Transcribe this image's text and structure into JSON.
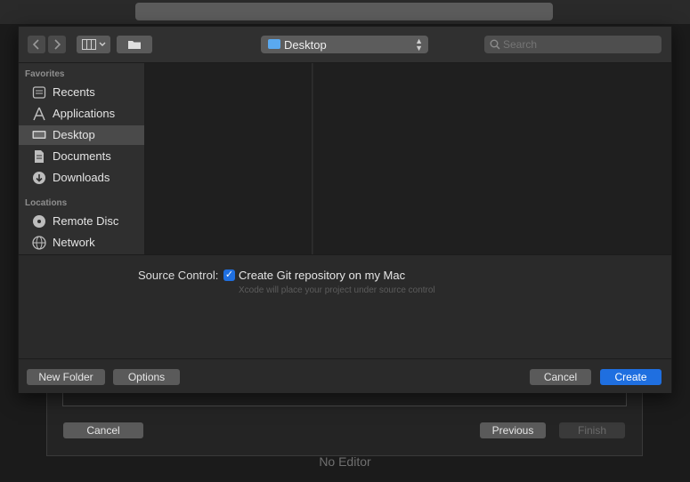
{
  "background": {
    "cancel_label": "Cancel",
    "previous_label": "Previous",
    "finish_label": "Finish",
    "no_editor": "No Editor"
  },
  "toolbar": {
    "location": "Desktop",
    "search_placeholder": "Search",
    "back_icon": "chevron-left-icon",
    "forward_icon": "chevron-right-icon",
    "view_icon": "column-view-icon",
    "new_folder_icon": "folder-icon"
  },
  "sidebar": {
    "favorites_header": "Favorites",
    "favorites": [
      {
        "label": "Recents",
        "icon": "clock-icon"
      },
      {
        "label": "Applications",
        "icon": "applications-icon"
      },
      {
        "label": "Desktop",
        "icon": "desktop-icon",
        "selected": true
      },
      {
        "label": "Documents",
        "icon": "document-icon"
      },
      {
        "label": "Downloads",
        "icon": "downloads-icon"
      }
    ],
    "locations_header": "Locations",
    "locations": [
      {
        "label": "Remote Disc",
        "icon": "disc-icon"
      },
      {
        "label": "Network",
        "icon": "globe-icon"
      }
    ]
  },
  "source_control": {
    "label": "Source Control:",
    "checkbox_label": "Create Git repository on my Mac",
    "checked": true,
    "note": "Xcode will place your project under source control"
  },
  "buttons": {
    "new_folder": "New Folder",
    "options": "Options",
    "cancel": "Cancel",
    "create": "Create"
  },
  "colors": {
    "accent": "#1f6fe0",
    "folder": "#5aa9f0"
  }
}
